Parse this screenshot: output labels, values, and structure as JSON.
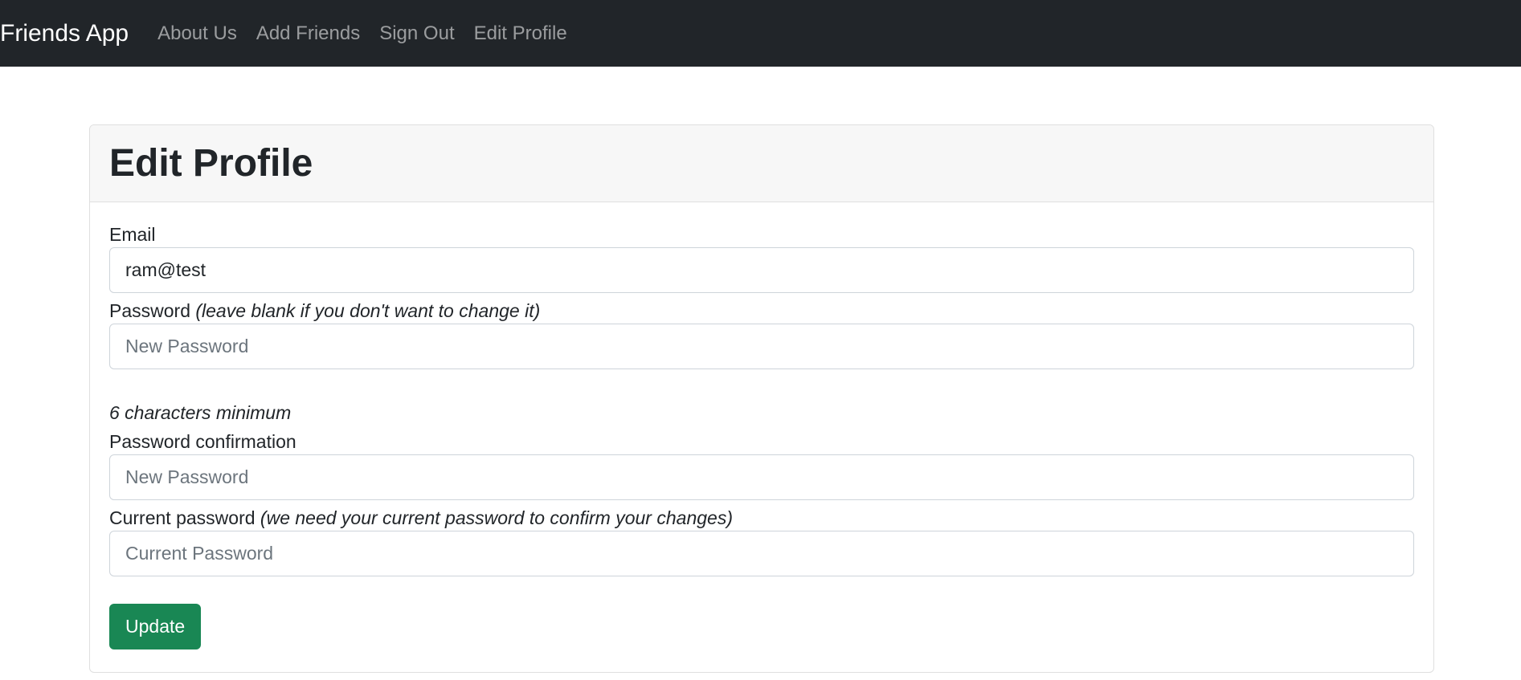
{
  "navbar": {
    "brand": "Friends App",
    "links": [
      {
        "label": "About Us"
      },
      {
        "label": "Add Friends"
      },
      {
        "label": "Sign Out"
      },
      {
        "label": "Edit Profile"
      }
    ]
  },
  "page": {
    "title": "Edit Profile"
  },
  "form": {
    "email": {
      "label": "Email",
      "value": "ram@test"
    },
    "password": {
      "label": "Password",
      "hint": "(leave blank if you don't want to change it)",
      "placeholder": "New Password",
      "note": "6 characters minimum"
    },
    "password_confirmation": {
      "label": "Password confirmation",
      "placeholder": "New Password"
    },
    "current_password": {
      "label": "Current password",
      "hint": "(we need your current password to confirm your changes)",
      "placeholder": "Current Password"
    },
    "submit_label": "Update"
  },
  "colors": {
    "navbar_bg": "#212529",
    "card_header_bg": "#f7f7f7",
    "button_bg": "#198754"
  }
}
